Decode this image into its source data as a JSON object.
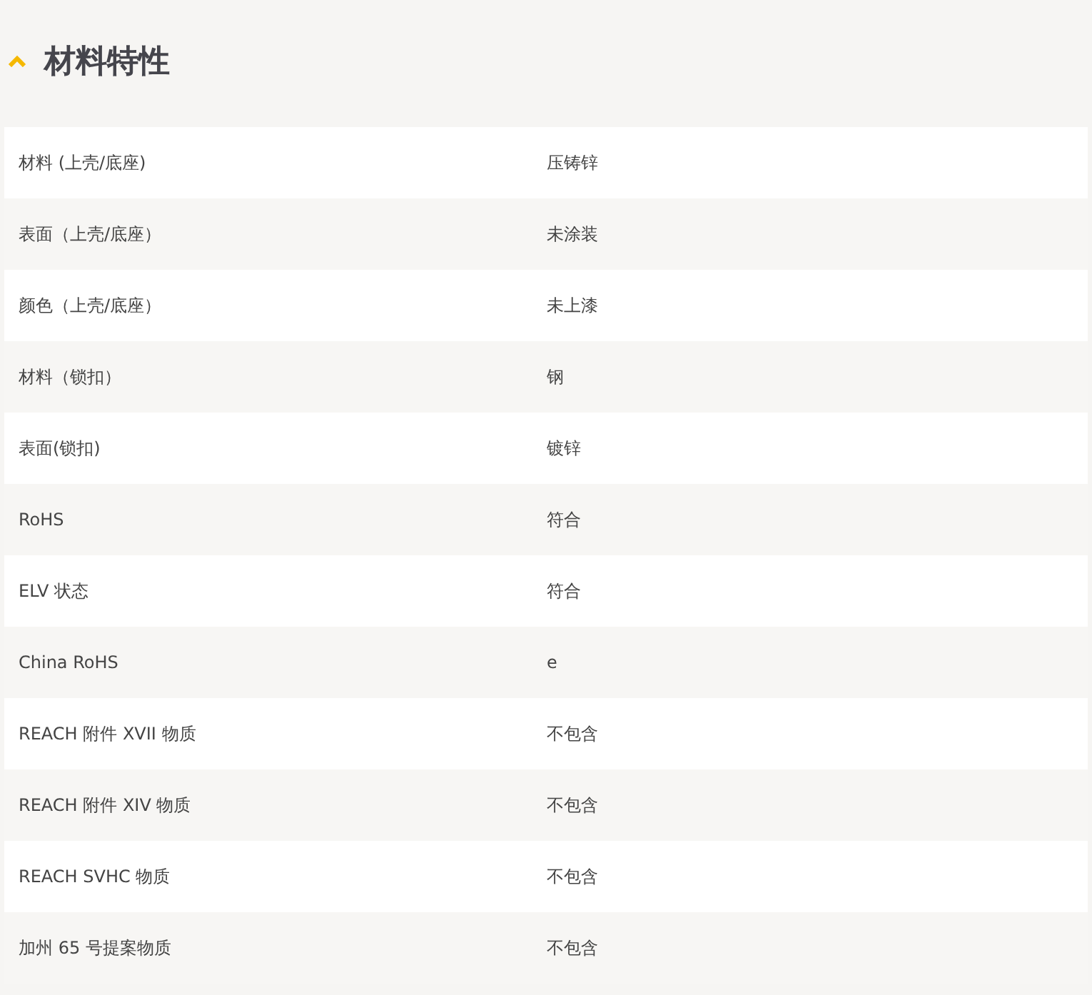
{
  "section": {
    "title": "材料特性",
    "expanded": true
  },
  "rows": [
    {
      "label": "材料 (上壳/底座)",
      "value": "压铸锌"
    },
    {
      "label": "表面（上壳/底座）",
      "value": "未涂装"
    },
    {
      "label": "颜色（上壳/底座）",
      "value": "未上漆"
    },
    {
      "label": "材料（锁扣）",
      "value": "钢"
    },
    {
      "label": "表面(锁扣)",
      "value": "镀锌"
    },
    {
      "label": "RoHS",
      "value": "符合"
    },
    {
      "label": "ELV 状态",
      "value": "符合"
    },
    {
      "label": "China RoHS",
      "value": "e"
    },
    {
      "label": "REACH 附件 XVII 物质",
      "value": "不包含"
    },
    {
      "label": "REACH 附件 XIV 物质",
      "value": "不包含"
    },
    {
      "label": "REACH SVHC 物质",
      "value": "不包含"
    },
    {
      "label": "加州 65 号提案物质",
      "value": "不包含"
    }
  ]
}
